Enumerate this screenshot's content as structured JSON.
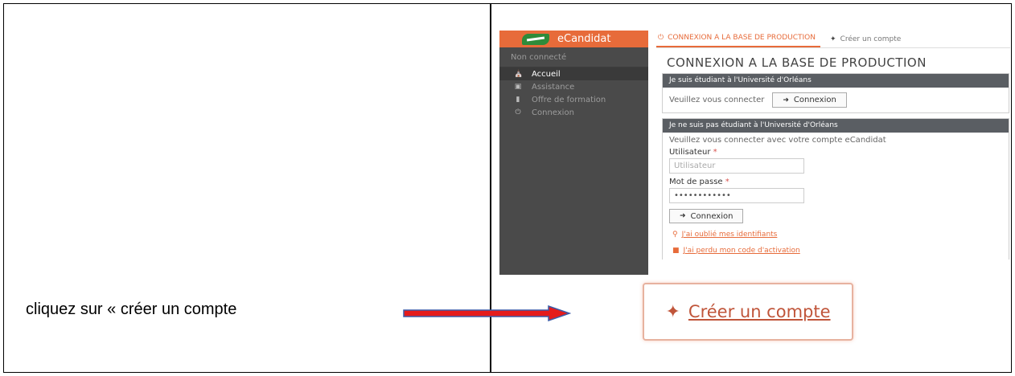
{
  "instruction": "cliquez sur « créer un compte",
  "colors": {
    "accent": "#e76b3a",
    "arrow": "#e51b1b",
    "arrow_outline": "#3b5ca8"
  },
  "screenshot": {
    "logo_text": "eCandidat",
    "sidebar": {
      "status": "Non connecté",
      "items": [
        {
          "label": "Accueil",
          "icon": "home-icon",
          "active": true
        },
        {
          "label": "Assistance",
          "icon": "support-icon",
          "active": false
        },
        {
          "label": "Offre de formation",
          "icon": "bookmark-icon",
          "active": false
        },
        {
          "label": "Connexion",
          "icon": "power-icon",
          "active": false
        }
      ]
    },
    "tabs": [
      {
        "label": "CONNEXION A LA BASE DE PRODUCTION",
        "icon": "power-icon",
        "active": true
      },
      {
        "label": "Créer un compte",
        "icon": "magic-wand-icon",
        "active": false
      }
    ],
    "page_title": "CONNEXION A LA BASE DE PRODUCTION",
    "panel_student": {
      "heading": "Je suis étudiant à l'Université d'Orléans",
      "prompt": "Veuillez vous connecter",
      "button": "Connexion"
    },
    "panel_other": {
      "heading": "Je ne suis pas étudiant à l'Université d'Orléans",
      "prompt": "Veuillez vous connecter avec votre compte eCandidat",
      "user_label": "Utilisateur",
      "user_placeholder": "Utilisateur",
      "password_label": "Mot de passe",
      "password_value": "••••••••••••",
      "required_mark": "*",
      "button": "Connexion",
      "forgot_ids": "J'ai oublié mes identifiants",
      "lost_code": "J'ai perdu mon code d'activation"
    }
  },
  "zoom_button": {
    "label": "Créer un compte",
    "icon": "magic-wand-icon"
  }
}
